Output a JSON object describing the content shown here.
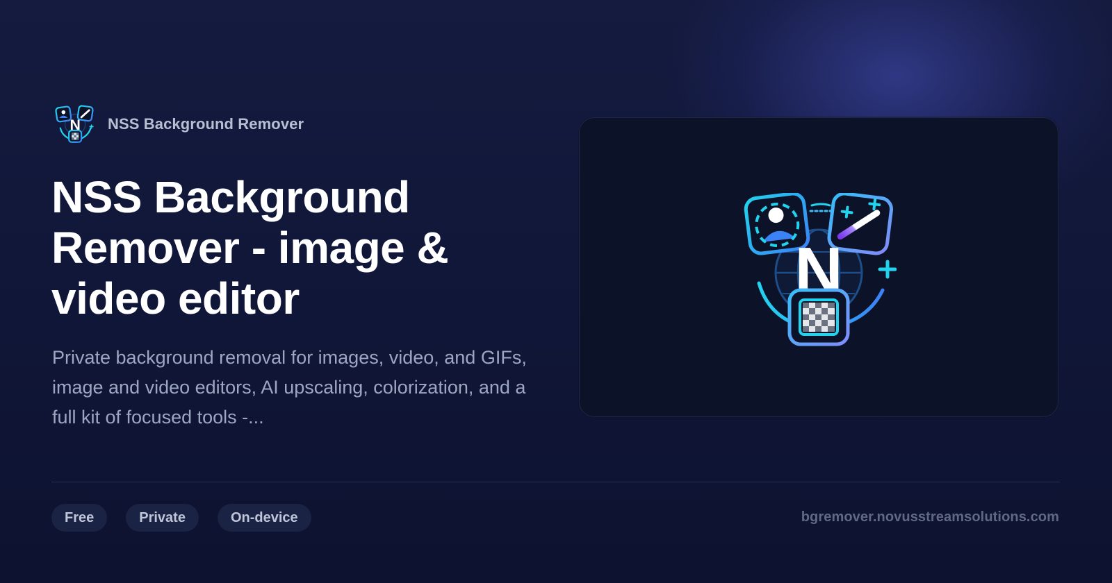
{
  "brand": {
    "name": "NSS Background Remover"
  },
  "hero": {
    "title": "NSS Background Remover - image & video editor",
    "description": "Private background removal for images, video, and GIFs, image and video editors, AI upscaling, colorization, and a full kit of focused tools -..."
  },
  "tags": [
    {
      "label": "Free"
    },
    {
      "label": "Private"
    },
    {
      "label": "On-device"
    }
  ],
  "footer": {
    "url": "bgremover.novusstreamsolutions.com"
  },
  "icons": {
    "brand_logo": "nss-logo-icon",
    "hero_logo": "nss-logo-icon"
  },
  "colors": {
    "background": "#111739",
    "card": "#0c1328",
    "accent_cyan": "#22d3ee",
    "accent_blue": "#3b82f6",
    "accent_purple": "#7c3aed"
  }
}
